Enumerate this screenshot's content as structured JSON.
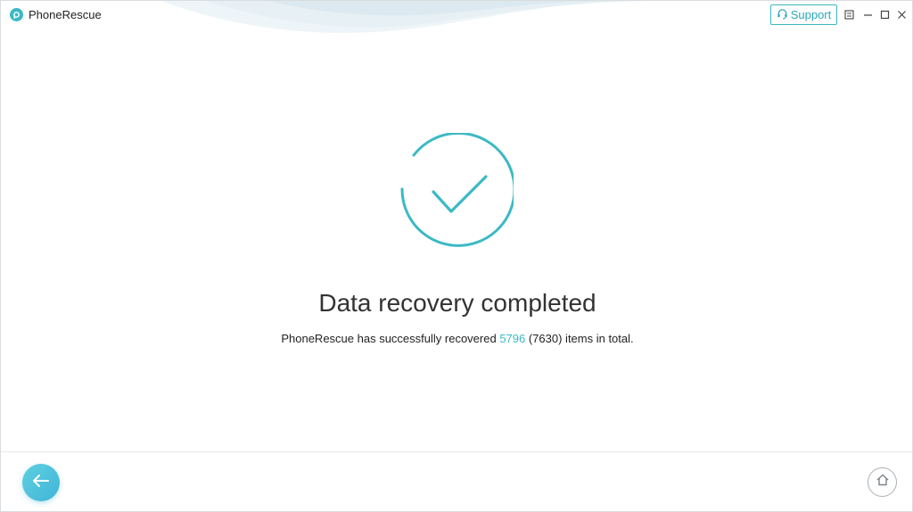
{
  "window": {
    "title": "PhoneRescue",
    "support_label": "Support"
  },
  "result": {
    "headline": "Data recovery completed",
    "summary_prefix": "PhoneRescue has successfully recovered ",
    "recovered_count": "5796",
    "total_count": " (7630)",
    "summary_suffix": " items in total."
  },
  "icons": {
    "logo": "phonerescue-logo-icon",
    "support": "headset-icon",
    "menu": "menu-icon",
    "minimize": "minimize-icon",
    "maximize": "maximize-icon",
    "close": "close-icon",
    "status": "checkmark-circle-icon",
    "back": "arrow-left-icon",
    "home": "home-icon"
  },
  "colors": {
    "accent": "#3cb9c5",
    "back_button": "#4cc3dc",
    "text": "#333333"
  }
}
